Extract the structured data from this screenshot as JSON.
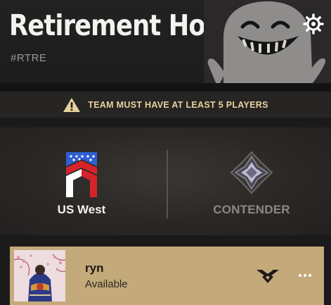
{
  "team": {
    "name": "Retirement Home",
    "tag": "#RTRE"
  },
  "warning": {
    "icon": "warning-icon",
    "text": "TEAM MUST HAVE AT LEAST 5 PLAYERS"
  },
  "region": {
    "icon": "us-flag-icon",
    "label": "US West"
  },
  "rank": {
    "icon": "contender-rank-icon",
    "label": "CONTENDER"
  },
  "members": [
    {
      "name": "ryn",
      "status": "Available",
      "avatar": "avatar",
      "rank_icon": "member-rank-icon"
    }
  ],
  "colors": {
    "accent_gold": "#c4aa7a",
    "warning_text": "#e8d39e",
    "background": "#1b1a1a"
  }
}
